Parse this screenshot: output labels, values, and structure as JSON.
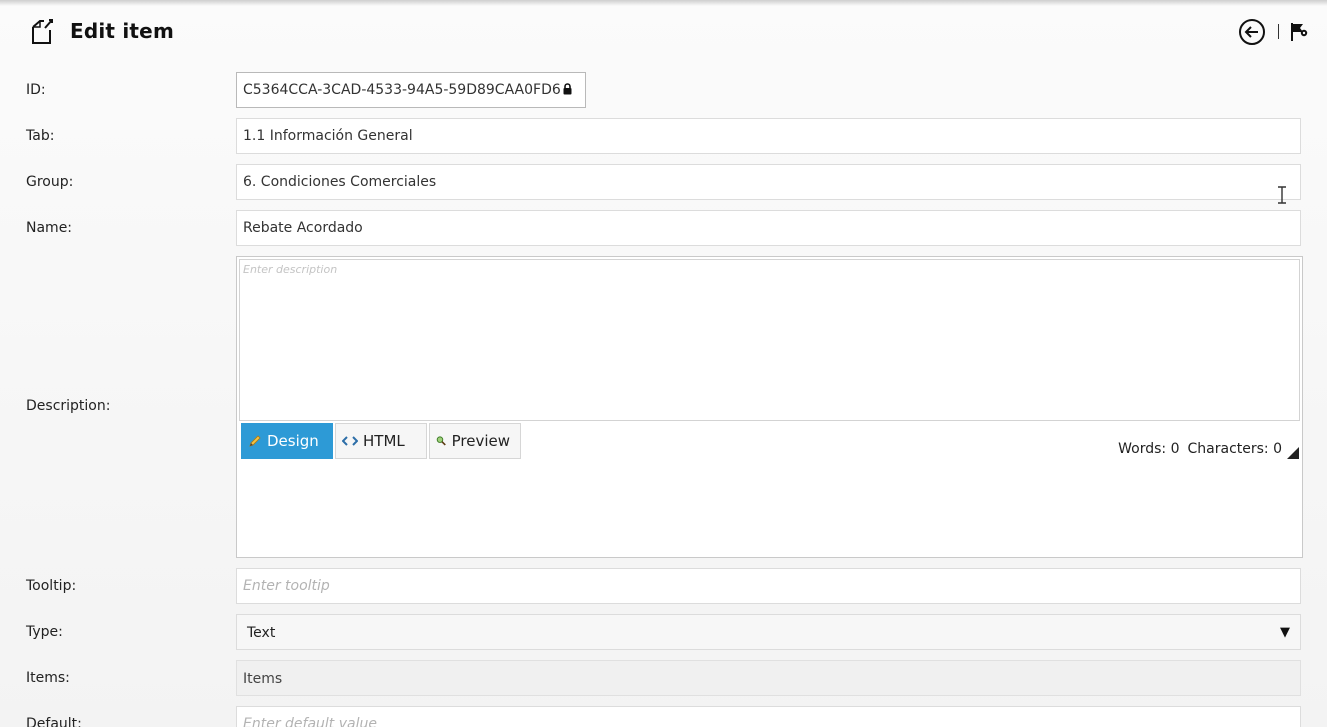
{
  "header": {
    "title": "Edit item",
    "icons": {
      "title": "edit-document-icon",
      "back": "arrow-left-circle-icon",
      "flag": "flag-gear-icon"
    }
  },
  "form": {
    "id": {
      "label": "ID:",
      "value": "C5364CCA-3CAD-4533-94A5-59D89CAA0FD6"
    },
    "tab": {
      "label": "Tab:",
      "value": "1.1 Información General"
    },
    "group": {
      "label": "Group:",
      "value": "6. Condiciones Comerciales"
    },
    "name": {
      "label": "Name:",
      "value": "Rebate Acordado"
    },
    "description": {
      "label": "Description:",
      "placeholder": "Enter description",
      "tabs": [
        {
          "label": "Design",
          "active": true
        },
        {
          "label": "HTML",
          "active": false
        },
        {
          "label": "Preview",
          "active": false
        }
      ],
      "words_label": "Words: 0",
      "chars_label": "Characters: 0"
    },
    "tooltip": {
      "label": "Tooltip:",
      "placeholder": "Enter tooltip"
    },
    "type": {
      "label": "Type:",
      "value": "Text"
    },
    "items": {
      "label": "Items:",
      "value": "Items"
    },
    "default": {
      "label": "Default:",
      "placeholder": "Enter default value"
    }
  },
  "colors": {
    "accent": "#2d9ad6",
    "border": "#dcdcdc"
  }
}
